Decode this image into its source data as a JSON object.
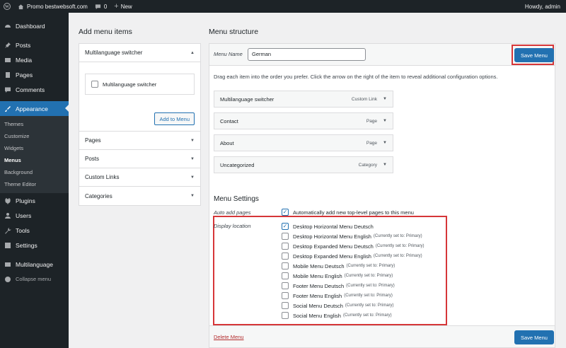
{
  "adminbar": {
    "site_name": "Promo bestwebsoft.com",
    "comments_count": "0",
    "new_label": "New",
    "howdy": "Howdy, admin"
  },
  "sidebar": {
    "items_top": [
      {
        "label": "Dashboard",
        "icon": "dashboard-icon"
      },
      {
        "label": "Posts",
        "icon": "pin-icon"
      },
      {
        "label": "Media",
        "icon": "media-icon"
      },
      {
        "label": "Pages",
        "icon": "page-icon"
      },
      {
        "label": "Comments",
        "icon": "comment-icon"
      }
    ],
    "current": {
      "label": "Appearance",
      "icon": "brush-icon"
    },
    "submenu": [
      "Themes",
      "Customize",
      "Widgets",
      "Menus",
      "Background",
      "Theme Editor"
    ],
    "submenu_active": "Menus",
    "items_bottom": [
      {
        "label": "Plugins",
        "icon": "plug-icon"
      },
      {
        "label": "Users",
        "icon": "user-icon"
      },
      {
        "label": "Tools",
        "icon": "wrench-icon"
      },
      {
        "label": "Settings",
        "icon": "settings-icon"
      },
      {
        "label": "Multilanguage",
        "icon": "language-icon"
      },
      {
        "label": "Collapse menu",
        "icon": "collapse-icon"
      }
    ]
  },
  "add_items": {
    "heading": "Add menu items",
    "open_section": "Multilanguage switcher",
    "checkbox_label": "Multilanguage switcher",
    "add_button": "Add to Menu",
    "sections": [
      "Pages",
      "Posts",
      "Custom Links",
      "Categories"
    ]
  },
  "structure": {
    "heading": "Menu structure",
    "menu_name_label": "Menu Name",
    "menu_name_value": "German",
    "save_label": "Save Menu",
    "instructions": "Drag each item into the order you prefer. Click the arrow on the right of the item to reveal additional configuration options.",
    "items": [
      {
        "title": "Multilanguage switcher",
        "type": "Custom Link"
      },
      {
        "title": "Contact",
        "type": "Page"
      },
      {
        "title": "About",
        "type": "Page"
      },
      {
        "title": "Uncategorized",
        "type": "Category"
      }
    ],
    "settings_heading": "Menu Settings",
    "auto_add_label": "Auto add pages",
    "auto_add_text": "Automatically add new top-level pages to this menu",
    "display_location_label": "Display location",
    "locations": [
      {
        "name": "Desktop Horizontal Menu Deutsch",
        "note": "",
        "checked": true
      },
      {
        "name": "Desktop Horizontal Menu English",
        "note": "(Currently set to: Primary)",
        "checked": false
      },
      {
        "name": "Desktop Expanded Menu Deutsch",
        "note": "(Currently set to: Primary)",
        "checked": false
      },
      {
        "name": "Desktop Expanded Menu English",
        "note": "(Currently set to: Primary)",
        "checked": false
      },
      {
        "name": "Mobile Menu Deutsch",
        "note": "(Currently set to: Primary)",
        "checked": false
      },
      {
        "name": "Mobile Menu English",
        "note": "(Currently set to: Primary)",
        "checked": false
      },
      {
        "name": "Footer Menu Deutsch",
        "note": "(Currently set to: Primary)",
        "checked": false
      },
      {
        "name": "Footer Menu English",
        "note": "(Currently set to: Primary)",
        "checked": false
      },
      {
        "name": "Social Menu Deutsch",
        "note": "(Currently set to: Primary)",
        "checked": false
      },
      {
        "name": "Social Menu English",
        "note": "(Currently set to: Primary)",
        "checked": false
      }
    ],
    "delete_label": "Delete Menu"
  },
  "colors": {
    "accent": "#2271b1",
    "admin_dark": "#1d2327",
    "highlight_box": "#d63638"
  }
}
